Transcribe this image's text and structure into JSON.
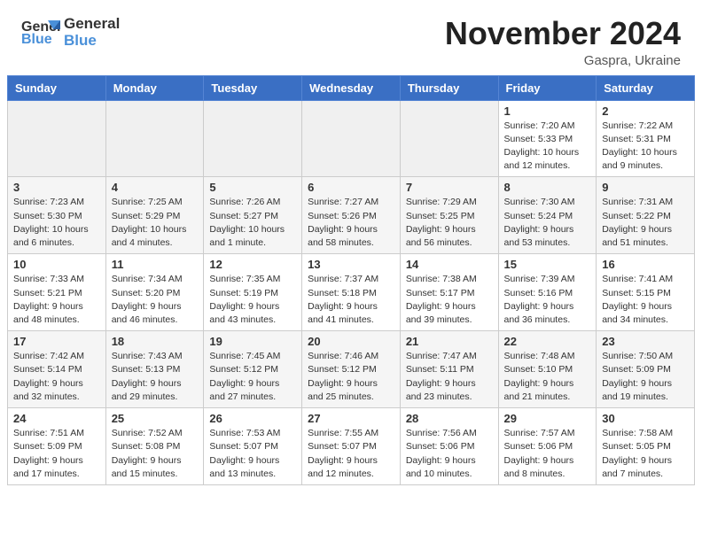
{
  "header": {
    "logo_line1": "General",
    "logo_line2": "Blue",
    "month": "November 2024",
    "location": "Gaspra, Ukraine"
  },
  "weekdays": [
    "Sunday",
    "Monday",
    "Tuesday",
    "Wednesday",
    "Thursday",
    "Friday",
    "Saturday"
  ],
  "weeks": [
    [
      {
        "day": "",
        "info": ""
      },
      {
        "day": "",
        "info": ""
      },
      {
        "day": "",
        "info": ""
      },
      {
        "day": "",
        "info": ""
      },
      {
        "day": "",
        "info": ""
      },
      {
        "day": "1",
        "info": "Sunrise: 7:20 AM\nSunset: 5:33 PM\nDaylight: 10 hours\nand 12 minutes."
      },
      {
        "day": "2",
        "info": "Sunrise: 7:22 AM\nSunset: 5:31 PM\nDaylight: 10 hours\nand 9 minutes."
      }
    ],
    [
      {
        "day": "3",
        "info": "Sunrise: 7:23 AM\nSunset: 5:30 PM\nDaylight: 10 hours\nand 6 minutes."
      },
      {
        "day": "4",
        "info": "Sunrise: 7:25 AM\nSunset: 5:29 PM\nDaylight: 10 hours\nand 4 minutes."
      },
      {
        "day": "5",
        "info": "Sunrise: 7:26 AM\nSunset: 5:27 PM\nDaylight: 10 hours\nand 1 minute."
      },
      {
        "day": "6",
        "info": "Sunrise: 7:27 AM\nSunset: 5:26 PM\nDaylight: 9 hours\nand 58 minutes."
      },
      {
        "day": "7",
        "info": "Sunrise: 7:29 AM\nSunset: 5:25 PM\nDaylight: 9 hours\nand 56 minutes."
      },
      {
        "day": "8",
        "info": "Sunrise: 7:30 AM\nSunset: 5:24 PM\nDaylight: 9 hours\nand 53 minutes."
      },
      {
        "day": "9",
        "info": "Sunrise: 7:31 AM\nSunset: 5:22 PM\nDaylight: 9 hours\nand 51 minutes."
      }
    ],
    [
      {
        "day": "10",
        "info": "Sunrise: 7:33 AM\nSunset: 5:21 PM\nDaylight: 9 hours\nand 48 minutes."
      },
      {
        "day": "11",
        "info": "Sunrise: 7:34 AM\nSunset: 5:20 PM\nDaylight: 9 hours\nand 46 minutes."
      },
      {
        "day": "12",
        "info": "Sunrise: 7:35 AM\nSunset: 5:19 PM\nDaylight: 9 hours\nand 43 minutes."
      },
      {
        "day": "13",
        "info": "Sunrise: 7:37 AM\nSunset: 5:18 PM\nDaylight: 9 hours\nand 41 minutes."
      },
      {
        "day": "14",
        "info": "Sunrise: 7:38 AM\nSunset: 5:17 PM\nDaylight: 9 hours\nand 39 minutes."
      },
      {
        "day": "15",
        "info": "Sunrise: 7:39 AM\nSunset: 5:16 PM\nDaylight: 9 hours\nand 36 minutes."
      },
      {
        "day": "16",
        "info": "Sunrise: 7:41 AM\nSunset: 5:15 PM\nDaylight: 9 hours\nand 34 minutes."
      }
    ],
    [
      {
        "day": "17",
        "info": "Sunrise: 7:42 AM\nSunset: 5:14 PM\nDaylight: 9 hours\nand 32 minutes."
      },
      {
        "day": "18",
        "info": "Sunrise: 7:43 AM\nSunset: 5:13 PM\nDaylight: 9 hours\nand 29 minutes."
      },
      {
        "day": "19",
        "info": "Sunrise: 7:45 AM\nSunset: 5:12 PM\nDaylight: 9 hours\nand 27 minutes."
      },
      {
        "day": "20",
        "info": "Sunrise: 7:46 AM\nSunset: 5:12 PM\nDaylight: 9 hours\nand 25 minutes."
      },
      {
        "day": "21",
        "info": "Sunrise: 7:47 AM\nSunset: 5:11 PM\nDaylight: 9 hours\nand 23 minutes."
      },
      {
        "day": "22",
        "info": "Sunrise: 7:48 AM\nSunset: 5:10 PM\nDaylight: 9 hours\nand 21 minutes."
      },
      {
        "day": "23",
        "info": "Sunrise: 7:50 AM\nSunset: 5:09 PM\nDaylight: 9 hours\nand 19 minutes."
      }
    ],
    [
      {
        "day": "24",
        "info": "Sunrise: 7:51 AM\nSunset: 5:09 PM\nDaylight: 9 hours\nand 17 minutes."
      },
      {
        "day": "25",
        "info": "Sunrise: 7:52 AM\nSunset: 5:08 PM\nDaylight: 9 hours\nand 15 minutes."
      },
      {
        "day": "26",
        "info": "Sunrise: 7:53 AM\nSunset: 5:07 PM\nDaylight: 9 hours\nand 13 minutes."
      },
      {
        "day": "27",
        "info": "Sunrise: 7:55 AM\nSunset: 5:07 PM\nDaylight: 9 hours\nand 12 minutes."
      },
      {
        "day": "28",
        "info": "Sunrise: 7:56 AM\nSunset: 5:06 PM\nDaylight: 9 hours\nand 10 minutes."
      },
      {
        "day": "29",
        "info": "Sunrise: 7:57 AM\nSunset: 5:06 PM\nDaylight: 9 hours\nand 8 minutes."
      },
      {
        "day": "30",
        "info": "Sunrise: 7:58 AM\nSunset: 5:05 PM\nDaylight: 9 hours\nand 7 minutes."
      }
    ]
  ]
}
